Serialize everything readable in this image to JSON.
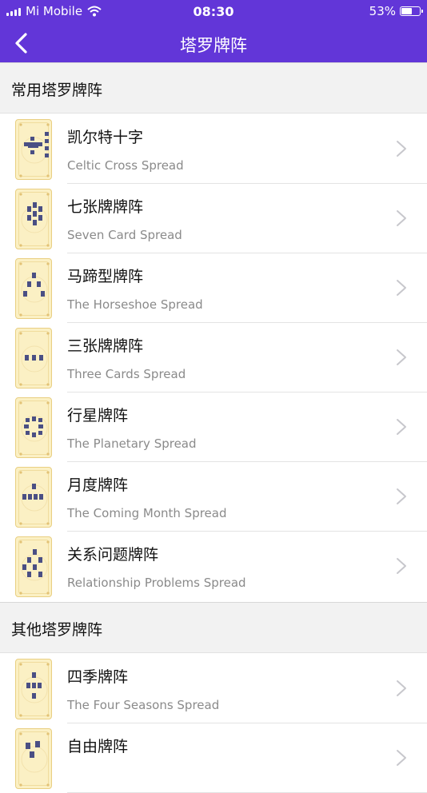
{
  "status": {
    "carrier": "Mi Mobile",
    "time": "08:30",
    "battery": "53%"
  },
  "nav": {
    "title": "塔罗牌阵"
  },
  "sections": [
    {
      "title": "常用塔罗牌阵"
    },
    {
      "title": "其他塔罗牌阵"
    }
  ],
  "spreads": [
    {
      "zh": "凯尔特十字",
      "en": "Celtic Cross Spread",
      "icon": "celtic-cross-icon"
    },
    {
      "zh": "七张牌牌阵",
      "en": "Seven Card Spread",
      "icon": "seven-card-icon"
    },
    {
      "zh": "马蹄型牌阵",
      "en": "The Horseshoe Spread",
      "icon": "horseshoe-icon"
    },
    {
      "zh": "三张牌牌阵",
      "en": "Three Cards Spread",
      "icon": "three-cards-icon"
    },
    {
      "zh": "行星牌阵",
      "en": "The Planetary Spread",
      "icon": "planetary-icon"
    },
    {
      "zh": "月度牌阵",
      "en": "The Coming Month Spread",
      "icon": "month-icon"
    },
    {
      "zh": "关系问题牌阵",
      "en": "Relationship Problems Spread",
      "icon": "relationship-icon"
    }
  ],
  "other_spreads": [
    {
      "zh": "四季牌阵",
      "en": "The Four Seasons Spread",
      "icon": "four-seasons-icon"
    },
    {
      "zh": "自由牌阵",
      "en": "",
      "icon": "free-spread-icon"
    }
  ],
  "colors": {
    "nav": "#6236d8",
    "card": "#fbf0c4",
    "card_border": "#e9cf82",
    "pip": "#4a4f84"
  }
}
